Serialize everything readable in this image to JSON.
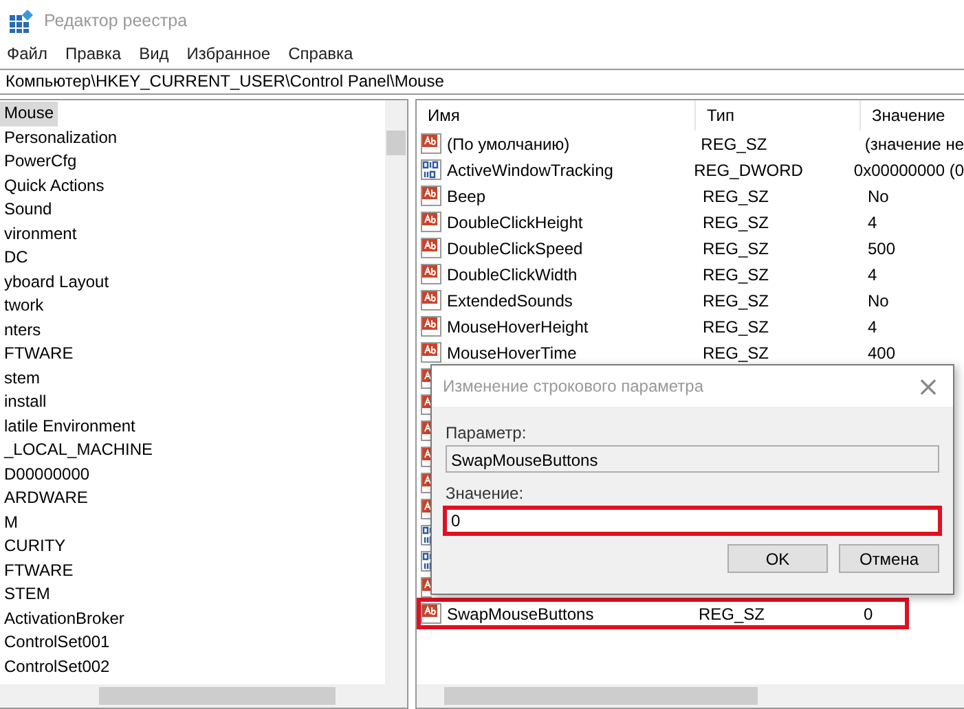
{
  "window": {
    "title": "Редактор реестра"
  },
  "menu": [
    "Файл",
    "Правка",
    "Вид",
    "Избранное",
    "Справка"
  ],
  "address": "Компьютер\\HKEY_CURRENT_USER\\Control Panel\\Mouse",
  "tree": [
    {
      "label": "Mouse",
      "selected": true
    },
    {
      "label": "Personalization",
      "selected": false
    },
    {
      "label": "PowerCfg",
      "selected": false
    },
    {
      "label": "Quick Actions",
      "selected": false
    },
    {
      "label": "Sound",
      "selected": false
    },
    {
      "label": "vironment",
      "selected": false
    },
    {
      "label": "DC",
      "selected": false
    },
    {
      "label": "yboard Layout",
      "selected": false
    },
    {
      "label": "twork",
      "selected": false
    },
    {
      "label": "nters",
      "selected": false
    },
    {
      "label": "FTWARE",
      "selected": false
    },
    {
      "label": "stem",
      "selected": false
    },
    {
      "label": "install",
      "selected": false
    },
    {
      "label": "latile Environment",
      "selected": false
    },
    {
      "label": "_LOCAL_MACHINE",
      "selected": false
    },
    {
      "label": "D00000000",
      "selected": false
    },
    {
      "label": "ARDWARE",
      "selected": false
    },
    {
      "label": "M",
      "selected": false
    },
    {
      "label": "CURITY",
      "selected": false
    },
    {
      "label": "FTWARE",
      "selected": false
    },
    {
      "label": "STEM",
      "selected": false
    },
    {
      "label": "ActivationBroker",
      "selected": false
    },
    {
      "label": "ControlSet001",
      "selected": false
    },
    {
      "label": "ControlSet002",
      "selected": false
    }
  ],
  "table": {
    "columns": [
      "Имя",
      "Тип",
      "Значение"
    ],
    "rows": [
      {
        "kind": "sz",
        "name": "(По умолчанию)",
        "type": "REG_SZ",
        "value": "(значение не",
        "highlighted": false
      },
      {
        "kind": "dword",
        "name": "ActiveWindowTracking",
        "type": "REG_DWORD",
        "value": "0x00000000 (0",
        "highlighted": false
      },
      {
        "kind": "sz",
        "name": "Beep",
        "type": "REG_SZ",
        "value": "No",
        "highlighted": false
      },
      {
        "kind": "sz",
        "name": "DoubleClickHeight",
        "type": "REG_SZ",
        "value": "4",
        "highlighted": false
      },
      {
        "kind": "sz",
        "name": "DoubleClickSpeed",
        "type": "REG_SZ",
        "value": "500",
        "highlighted": false
      },
      {
        "kind": "sz",
        "name": "DoubleClickWidth",
        "type": "REG_SZ",
        "value": "4",
        "highlighted": false
      },
      {
        "kind": "sz",
        "name": "ExtendedSounds",
        "type": "REG_SZ",
        "value": "No",
        "highlighted": false
      },
      {
        "kind": "sz",
        "name": "MouseHoverHeight",
        "type": "REG_SZ",
        "value": "4",
        "highlighted": false
      },
      {
        "kind": "sz",
        "name": "MouseHoverTime",
        "type": "REG_SZ",
        "value": "400",
        "highlighted": false
      },
      {
        "kind": "sz",
        "highlighted": false
      },
      {
        "kind": "sz",
        "highlighted": false
      },
      {
        "kind": "sz",
        "highlighted": false
      },
      {
        "kind": "sz",
        "highlighted": false
      },
      {
        "kind": "sz",
        "highlighted": false
      },
      {
        "kind": "sz",
        "highlighted": false
      },
      {
        "kind": "dword",
        "highlighted": false
      },
      {
        "kind": "dword",
        "highlighted": false
      },
      {
        "kind": "sz",
        "highlighted": false
      },
      {
        "kind": "sz",
        "name": "SwapMouseButtons",
        "type": "REG_SZ",
        "value": "0",
        "highlighted": true
      }
    ]
  },
  "dialog": {
    "title": "Изменение строкового параметра",
    "close": "×",
    "name_label": "Параметр:",
    "name_value": "SwapMouseButtons",
    "value_label": "Значение:",
    "value": "0",
    "value_highlighted": true,
    "buttons": [
      "OK",
      "Отмена"
    ]
  }
}
